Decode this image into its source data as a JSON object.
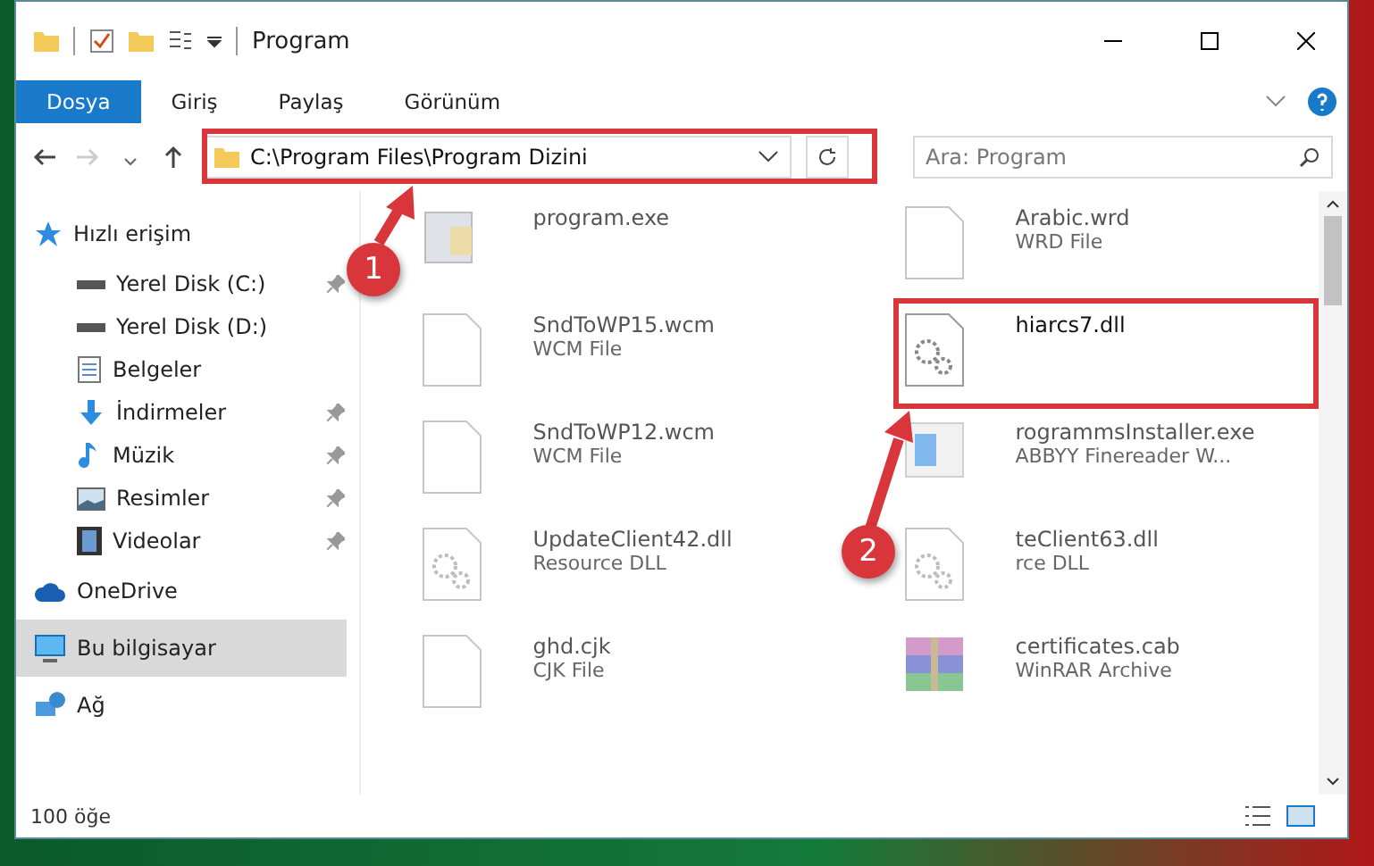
{
  "window": {
    "title": "Program"
  },
  "ribbon_tabs": [
    {
      "label": "Dosya",
      "selected": true
    },
    {
      "label": "Giriş",
      "selected": false
    },
    {
      "label": "Paylaş",
      "selected": false
    },
    {
      "label": "Görünüm",
      "selected": false
    }
  ],
  "address_bar": {
    "path": "C:\\Program Files\\Program Dizini"
  },
  "search": {
    "placeholder": "Ara: Program"
  },
  "sidebar": {
    "items": [
      {
        "label": "Hızlı erişim",
        "kind": "star",
        "selected": false,
        "children": [
          {
            "label": "Yerel Disk (C:)",
            "kind": "drive",
            "pinned": true
          },
          {
            "label": "Yerel Disk (D:)",
            "kind": "drive",
            "pinned": false
          },
          {
            "label": "Belgeler",
            "kind": "document",
            "pinned": false
          },
          {
            "label": "İndirmeler",
            "kind": "download",
            "pinned": true
          },
          {
            "label": "Müzik",
            "kind": "music",
            "pinned": true
          },
          {
            "label": "Resimler",
            "kind": "picture",
            "pinned": true
          },
          {
            "label": "Videolar",
            "kind": "video",
            "pinned": true
          }
        ]
      },
      {
        "label": "OneDrive",
        "kind": "cloud",
        "selected": false
      },
      {
        "label": "Bu bilgisayar",
        "kind": "computer",
        "selected": true
      },
      {
        "label": "Ağ",
        "kind": "network",
        "selected": false
      }
    ]
  },
  "files": [
    {
      "name": "program.exe",
      "kind": "exe",
      "dimmed": true
    },
    {
      "name": "Arabic.wrd",
      "type": "WRD File",
      "kind": "blank",
      "dimmed": true
    },
    {
      "name": "SndToWP15.wcm",
      "type": "WCM File",
      "kind": "blank",
      "dimmed": true
    },
    {
      "name": "hiarcs7.dll",
      "kind": "dll",
      "dimmed": false
    },
    {
      "name": "SndToWP12.wcm",
      "type": "WCM File",
      "kind": "blank",
      "dimmed": true
    },
    {
      "name": "rogrammsInstaller.exe",
      "type": "ABBYY Finereader W...",
      "kind": "installer",
      "dimmed": true
    },
    {
      "name": "UpdateClient42.dll",
      "type": "Resource DLL",
      "kind": "dll",
      "dimmed": true
    },
    {
      "name": "teClient63.dll",
      "type": "rce DLL",
      "kind": "dll",
      "dimmed": true
    },
    {
      "name": "ghd.cjk",
      "type": "CJK File",
      "kind": "blank",
      "dimmed": true
    },
    {
      "name": "certificates.cab",
      "type": "WinRAR Archive",
      "kind": "archive",
      "dimmed": true
    }
  ],
  "status_bar": {
    "count": "100 öğe"
  },
  "annotations": [
    {
      "label": "1"
    },
    {
      "label": "2"
    }
  ]
}
